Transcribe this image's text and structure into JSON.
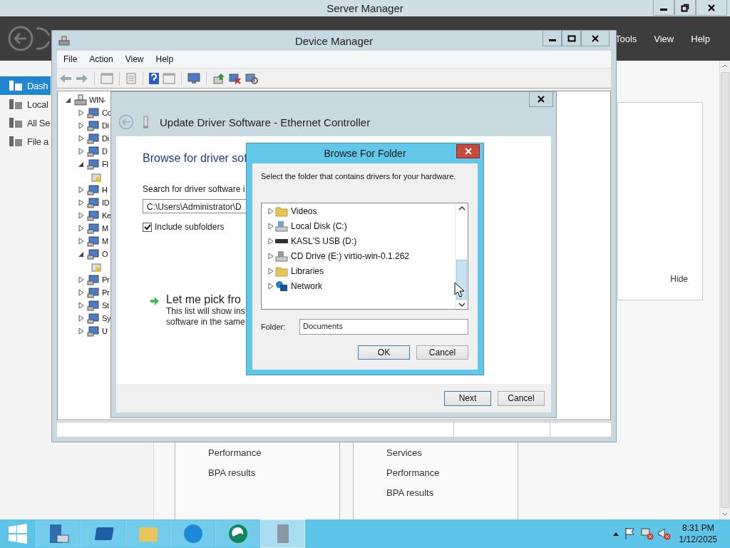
{
  "server_manager": {
    "title": "Server Manager",
    "menu": [
      "Tools",
      "View",
      "Help"
    ],
    "sidebar": [
      {
        "label": "Dash",
        "selected": true
      },
      {
        "label": "Local",
        "selected": false
      },
      {
        "label": "All Se",
        "selected": false
      },
      {
        "label": "File a",
        "selected": false
      }
    ],
    "panel": {
      "link": "Hide"
    },
    "tiles": [
      {
        "items": [
          "Performance",
          "BPA results"
        ]
      },
      {
        "items": [
          "Services",
          "Performance",
          "BPA results"
        ]
      }
    ]
  },
  "device_manager": {
    "title": "Device Manager",
    "menu": [
      "File",
      "Action",
      "View",
      "Help"
    ],
    "tree": {
      "kind": "computer",
      "label": "WIN-",
      "expanded": true,
      "children": [
        {
          "kind": "category",
          "label": "Co",
          "expanded": false
        },
        {
          "kind": "category",
          "label": "Di",
          "expanded": false
        },
        {
          "kind": "category",
          "label": "Di",
          "expanded": false
        },
        {
          "kind": "category",
          "label": "D",
          "expanded": false
        },
        {
          "kind": "category",
          "label": "Fl",
          "expanded": true,
          "children": [
            {
              "kind": "device"
            }
          ]
        },
        {
          "kind": "category",
          "label": "H",
          "expanded": false
        },
        {
          "kind": "category",
          "label": "ID",
          "expanded": false
        },
        {
          "kind": "category",
          "label": "Ke",
          "expanded": false
        },
        {
          "kind": "category",
          "label": "M",
          "expanded": false
        },
        {
          "kind": "category",
          "label": "M",
          "expanded": false
        },
        {
          "kind": "category",
          "label": "O",
          "expanded": true,
          "children": [
            {
              "kind": "device"
            }
          ]
        },
        {
          "kind": "category",
          "label": "Pr",
          "expanded": false
        },
        {
          "kind": "category",
          "label": "Pr",
          "expanded": false
        },
        {
          "kind": "category",
          "label": "St",
          "expanded": false
        },
        {
          "kind": "category",
          "label": "Sy",
          "expanded": false
        },
        {
          "kind": "category",
          "label": "U",
          "expanded": false
        }
      ]
    }
  },
  "update_driver": {
    "title": "Update Driver Software - Ethernet Controller",
    "heading": "Browse for driver sof",
    "search_label": "Search for driver software i",
    "path": "C:\\Users\\Administrator\\D",
    "include_subfolders": {
      "label": "Include subfolders",
      "checked": true
    },
    "pick_option": {
      "title": "Let me pick fro",
      "description": [
        "This list will show ins",
        "software in the same"
      ]
    },
    "buttons": [
      {
        "label": "Next",
        "default": true
      },
      {
        "label": "Cancel",
        "default": false
      }
    ]
  },
  "browse_dialog": {
    "title": "Browse For Folder",
    "instruction": "Select the folder that contains drivers for your hardware.",
    "folders": [
      {
        "kind": "group",
        "children": [
          {
            "kind": "videos",
            "label": "Videos",
            "expanded": false
          },
          {
            "kind": "disk",
            "label": "Local Disk (C:)",
            "expanded": false
          },
          {
            "kind": "usb",
            "label": "KASL'S USB (D:)",
            "expanded": false
          },
          {
            "kind": "cd",
            "label": "CD Drive (E:) virtio-win-0.1.262",
            "expanded": false
          }
        ]
      },
      {
        "kind": "libraries",
        "label": "Libraries",
        "expanded": false
      },
      {
        "kind": "network",
        "label": "Network",
        "expanded": false
      }
    ],
    "folder_label": "Folder:",
    "folder_value": "Documents",
    "buttons": [
      {
        "label": "OK",
        "default": true
      },
      {
        "label": "Cancel",
        "default": false
      }
    ]
  },
  "taskbar": {
    "apps": [
      {
        "kind": "server",
        "selected": false
      },
      {
        "kind": "powershell",
        "selected": false
      },
      {
        "kind": "explorer",
        "selected": false
      },
      {
        "kind": "browser",
        "selected": false
      },
      {
        "kind": "green",
        "selected": false
      },
      {
        "kind": "devmgr",
        "selected": true
      }
    ],
    "time": "8:31 PM",
    "date": "1/12/2025"
  }
}
